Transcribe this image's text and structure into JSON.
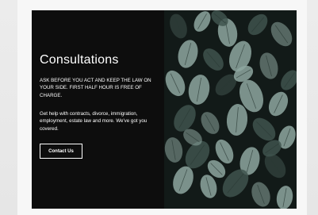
{
  "consult": {
    "title": "Consultations",
    "subtitle": "ASK BEFORE YOU ACT AND KEEP THE LAW ON YOUR SIDE. FIRST HALF HOUR IS FREE OF CHARGE.",
    "body": "Get help with contracts, divorce, immigration, employment, estate law and more. We've got you covered.",
    "cta_label": "Contact Us"
  },
  "colors": {
    "panel_bg": "#0d0d0d",
    "text": "#ffffff",
    "leaf_light": "#8ea7a0",
    "leaf_dark": "#3f544e",
    "photo_bg": "#121a18"
  },
  "icons": {
    "hero_image": "plant-leaves-photo"
  }
}
